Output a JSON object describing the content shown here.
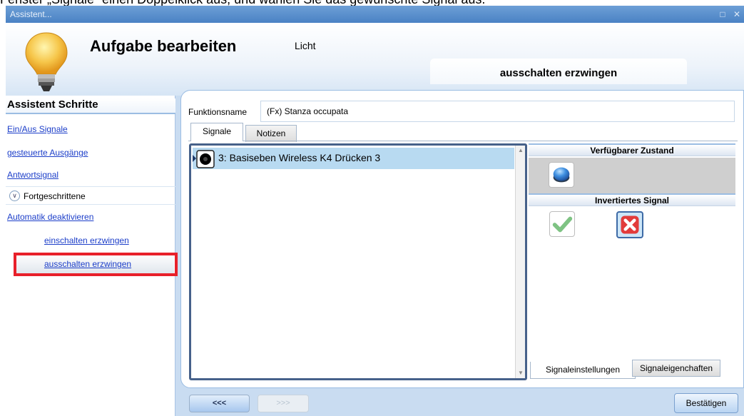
{
  "caption": "Fenster „Signale“ einen Doppelklick aus, und wählen Sie das gewünschte Signal aus.",
  "window": {
    "title": "Assistent...",
    "buttons": [
      "maximize-icon",
      "close-icon"
    ]
  },
  "header": {
    "title": "Aufgabe bearbeiten",
    "subtitle": "Licht",
    "current_step": "ausschalten erzwingen"
  },
  "sidebar": {
    "heading": "Assistent Schritte",
    "items": [
      {
        "label": "Ein/Aus Signale"
      },
      {
        "label": "gesteuerte Ausgänge"
      },
      {
        "label": "Antwortsignal"
      }
    ],
    "advanced_label": "Fortgeschrittene",
    "advanced_items": [
      {
        "label": "Automatik deaktivieren"
      },
      {
        "label": "einschalten erzwingen"
      },
      {
        "label": "ausschalten erzwingen",
        "selected": true
      }
    ]
  },
  "form": {
    "function_name_label": "Funktionsname",
    "function_name_value": "(Fx) Stanza occupata"
  },
  "tabs": [
    {
      "label": "Signale",
      "active": true
    },
    {
      "label": "Notizen",
      "active": false
    }
  ],
  "signals": [
    {
      "label": "3: Basiseben Wireless K4 Drücken 3",
      "selected": true
    }
  ],
  "properties": {
    "available_state_heading": "Verfügbarer Zustand",
    "inverted_signal_heading": "Invertiertes Signal",
    "inverted_value": false,
    "bottom_tabs": [
      {
        "label": "Signaleinstellungen",
        "active": true
      },
      {
        "label": "Signaleigenchaften",
        "active": false
      }
    ]
  },
  "nav": {
    "prev_label": "<<<",
    "next_label": ">>>",
    "confirm_label": "Bestätigen"
  },
  "colors": {
    "highlight": "#e8202a",
    "link": "#1c3ec9",
    "selection": "#b8daf1"
  }
}
